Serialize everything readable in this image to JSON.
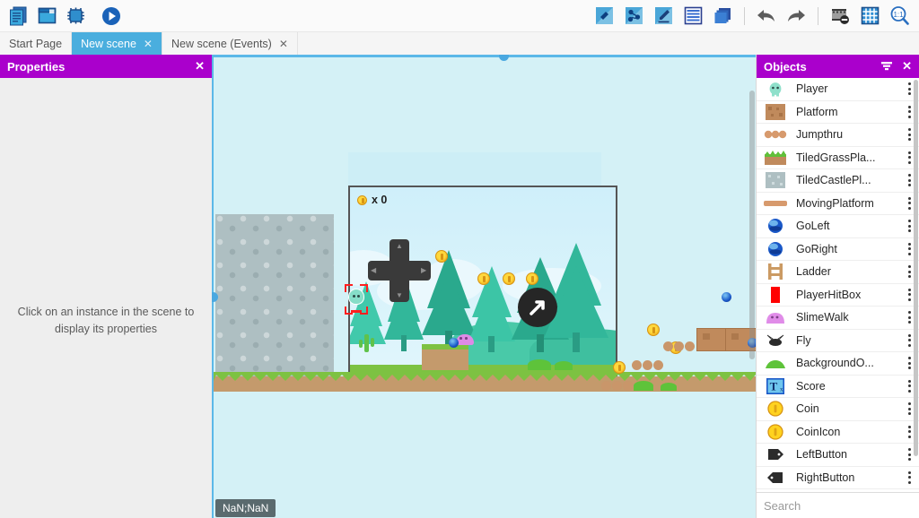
{
  "toolbar": {
    "left_buttons": [
      {
        "name": "open-project-manager",
        "icon": "stacked-pages-icon",
        "label": "Project manager"
      },
      {
        "name": "open-scene-editor",
        "icon": "window-icon",
        "label": "Scene editor"
      },
      {
        "name": "open-debugger",
        "icon": "bug-chip-icon",
        "label": "Debugger"
      },
      {
        "name": "preview-play",
        "icon": "play-circle-icon",
        "label": "Preview"
      }
    ],
    "right_buttons": [
      {
        "name": "add-object",
        "icon": "add-object-icon",
        "label": "Add a new object"
      },
      {
        "name": "add-instance",
        "icon": "add-instance-icon",
        "label": "Add a new instance"
      },
      {
        "name": "edit-instance",
        "icon": "pencil-edit-icon",
        "label": "Edit object"
      },
      {
        "name": "open-object-list",
        "icon": "list-icon",
        "label": "Objects list"
      },
      {
        "name": "open-layers",
        "icon": "layers-icon",
        "label": "Layers"
      },
      {
        "name": "undo",
        "icon": "undo-arrow-icon",
        "label": "Undo"
      },
      {
        "name": "redo",
        "icon": "redo-arrow-icon",
        "label": "Redo"
      },
      {
        "name": "toggle-mask",
        "icon": "no-film-icon",
        "label": "Toggle mask"
      },
      {
        "name": "toggle-grid",
        "icon": "grid-icon",
        "label": "Toggle grid"
      },
      {
        "name": "zoom-reset",
        "icon": "zoom-1-1-icon",
        "label": "Zoom 1:1"
      }
    ]
  },
  "tabs": [
    {
      "label": "Start Page",
      "active": false,
      "closable": false
    },
    {
      "label": "New scene",
      "active": true,
      "closable": true,
      "close_label": "✕"
    },
    {
      "label": "New scene (Events)",
      "active": false,
      "closable": true,
      "close_label": "✕"
    }
  ],
  "properties_panel": {
    "title": "Properties",
    "close_label": "✕",
    "hint": "Click on an instance in the scene to display its properties"
  },
  "objects_panel": {
    "title": "Objects",
    "filter_icon": "filter-funnel-icon",
    "close_label": "✕",
    "search_placeholder": "Search",
    "search_value": "",
    "search_icon": "magnifier-icon",
    "items": [
      {
        "label": "Player",
        "thumb": "player-sprite"
      },
      {
        "label": "Platform",
        "thumb": "crate-tile"
      },
      {
        "label": "Jumpthru",
        "thumb": "three-dots-platform"
      },
      {
        "label": "TiledGrassPla...",
        "thumb": "grass-tile"
      },
      {
        "label": "TiledCastlePl...",
        "thumb": "castle-tile"
      },
      {
        "label": "MovingPlatform",
        "thumb": "bar-platform"
      },
      {
        "label": "GoLeft",
        "thumb": "blue-sphere"
      },
      {
        "label": "GoRight",
        "thumb": "blue-sphere"
      },
      {
        "label": "Ladder",
        "thumb": "ladder-tile"
      },
      {
        "label": "PlayerHitBox",
        "thumb": "red-rect"
      },
      {
        "label": "SlimeWalk",
        "thumb": "pink-slime"
      },
      {
        "label": "Fly",
        "thumb": "black-fly"
      },
      {
        "label": "BackgroundO...",
        "thumb": "green-bush"
      },
      {
        "label": "Score",
        "thumb": "text-object"
      },
      {
        "label": "Coin",
        "thumb": "gold-coin"
      },
      {
        "label": "CoinIcon",
        "thumb": "gold-coin"
      },
      {
        "label": "LeftButton",
        "thumb": "left-arrow-tag"
      },
      {
        "label": "RightButton",
        "thumb": "right-arrow-tag"
      }
    ]
  },
  "scene": {
    "coordinates_label": "NaN;NaN",
    "hud_coin_label": "x 0",
    "background_color": "#d4f1f6",
    "selection_color": "#ff1f1f",
    "handle_color": "#4aa8e0"
  },
  "colors": {
    "panel_header": "#aa00cc",
    "active_tab": "#4aaede",
    "scene_bg": "#d4f1f6",
    "accent_blue": "#1a5fb4"
  }
}
